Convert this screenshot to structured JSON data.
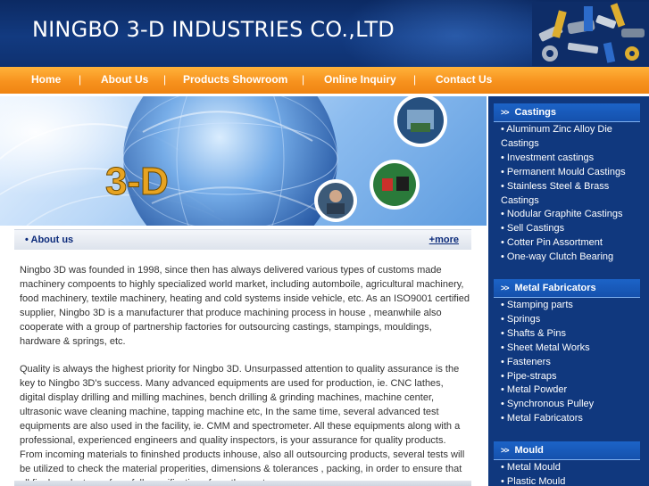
{
  "header": {
    "company_name": "NINGBO 3-D INDUSTRIES CO.,LTD"
  },
  "nav": {
    "items": [
      {
        "label": "Home"
      },
      {
        "label": "About Us"
      },
      {
        "label": "Products Showroom"
      },
      {
        "label": "Online Inquiry"
      },
      {
        "label": "Contact Us"
      }
    ],
    "separator": "|"
  },
  "banner": {
    "logo_text": "3-D"
  },
  "about": {
    "title": "• About us",
    "more_link": "+more",
    "paragraphs": [
      "Ningbo 3D was founded in 1998, since then has always delivered various types of customs made machinery compoents to highly specialized world market, including automboile, agricultural machinery, food machinery, textile machinery, heating and cold systems inside vehicle, etc. As an ISO9001 certified supplier, Ningbo 3D is a manufacturer that produce machining process in house , meanwhile also cooperate with a group of partnership factories for outsourcing castings, stampings, mouldings, hardware & springs, etc.",
      "Quality is always the highest priority for Ningbo 3D. Unsurpassed attention to quality assurance is the key to Ningbo 3D's success. Many advanced equipments are used for production, ie. CNC lathes, digital display drilling and milling machines, bench drilling & grinding machines, machine center, ultrasonic wave cleaning machine, tapping machine etc, In the same time, several advanced test equipments are also used in the facility, ie. CMM and spectrometer. All these equipments along with a professional, experienced engineers and quality inspectors, is your assurance for quality products. From incoming materials to fininshed products inhouse, also all outsourcing products, several tests will be utilized to check the material properities, dimensions & tolerances , packing, in order to ensure that all final products conform full specifications from the customers .."
    ]
  },
  "sidebar": {
    "categories": [
      {
        "arrows": ">>",
        "title": "Castings",
        "items": [
          "• Aluminum Zinc Alloy Die Castings",
          "• Investment castings",
          "• Permanent Mould Castings",
          "• Stainless Steel & Brass Castings",
          "• Nodular Graphite Castings",
          "• Sell Castings",
          "• Cotter Pin Assortment",
          "• One-way Clutch Bearing"
        ]
      },
      {
        "arrows": ">>",
        "title": "Metal Fabricators",
        "items": [
          "• Stamping parts",
          "• Springs",
          "• Shafts & Pins",
          "• Sheet Metal Works",
          "• Fasteners",
          "• Pipe-straps",
          "• Metal Powder",
          "• Synchronous Pulley",
          "• Metal Fabricators"
        ]
      },
      {
        "arrows": ">>",
        "title": "Mould",
        "items": [
          "• Metal Mould",
          "• Plastic Mould"
        ]
      }
    ]
  },
  "colors": {
    "header_blue": "#123a80",
    "nav_orange": "#f7921e",
    "sidebar_blue": "#10387e",
    "category_blue": "#1c63c7",
    "link_blue": "#0b2a7a"
  }
}
